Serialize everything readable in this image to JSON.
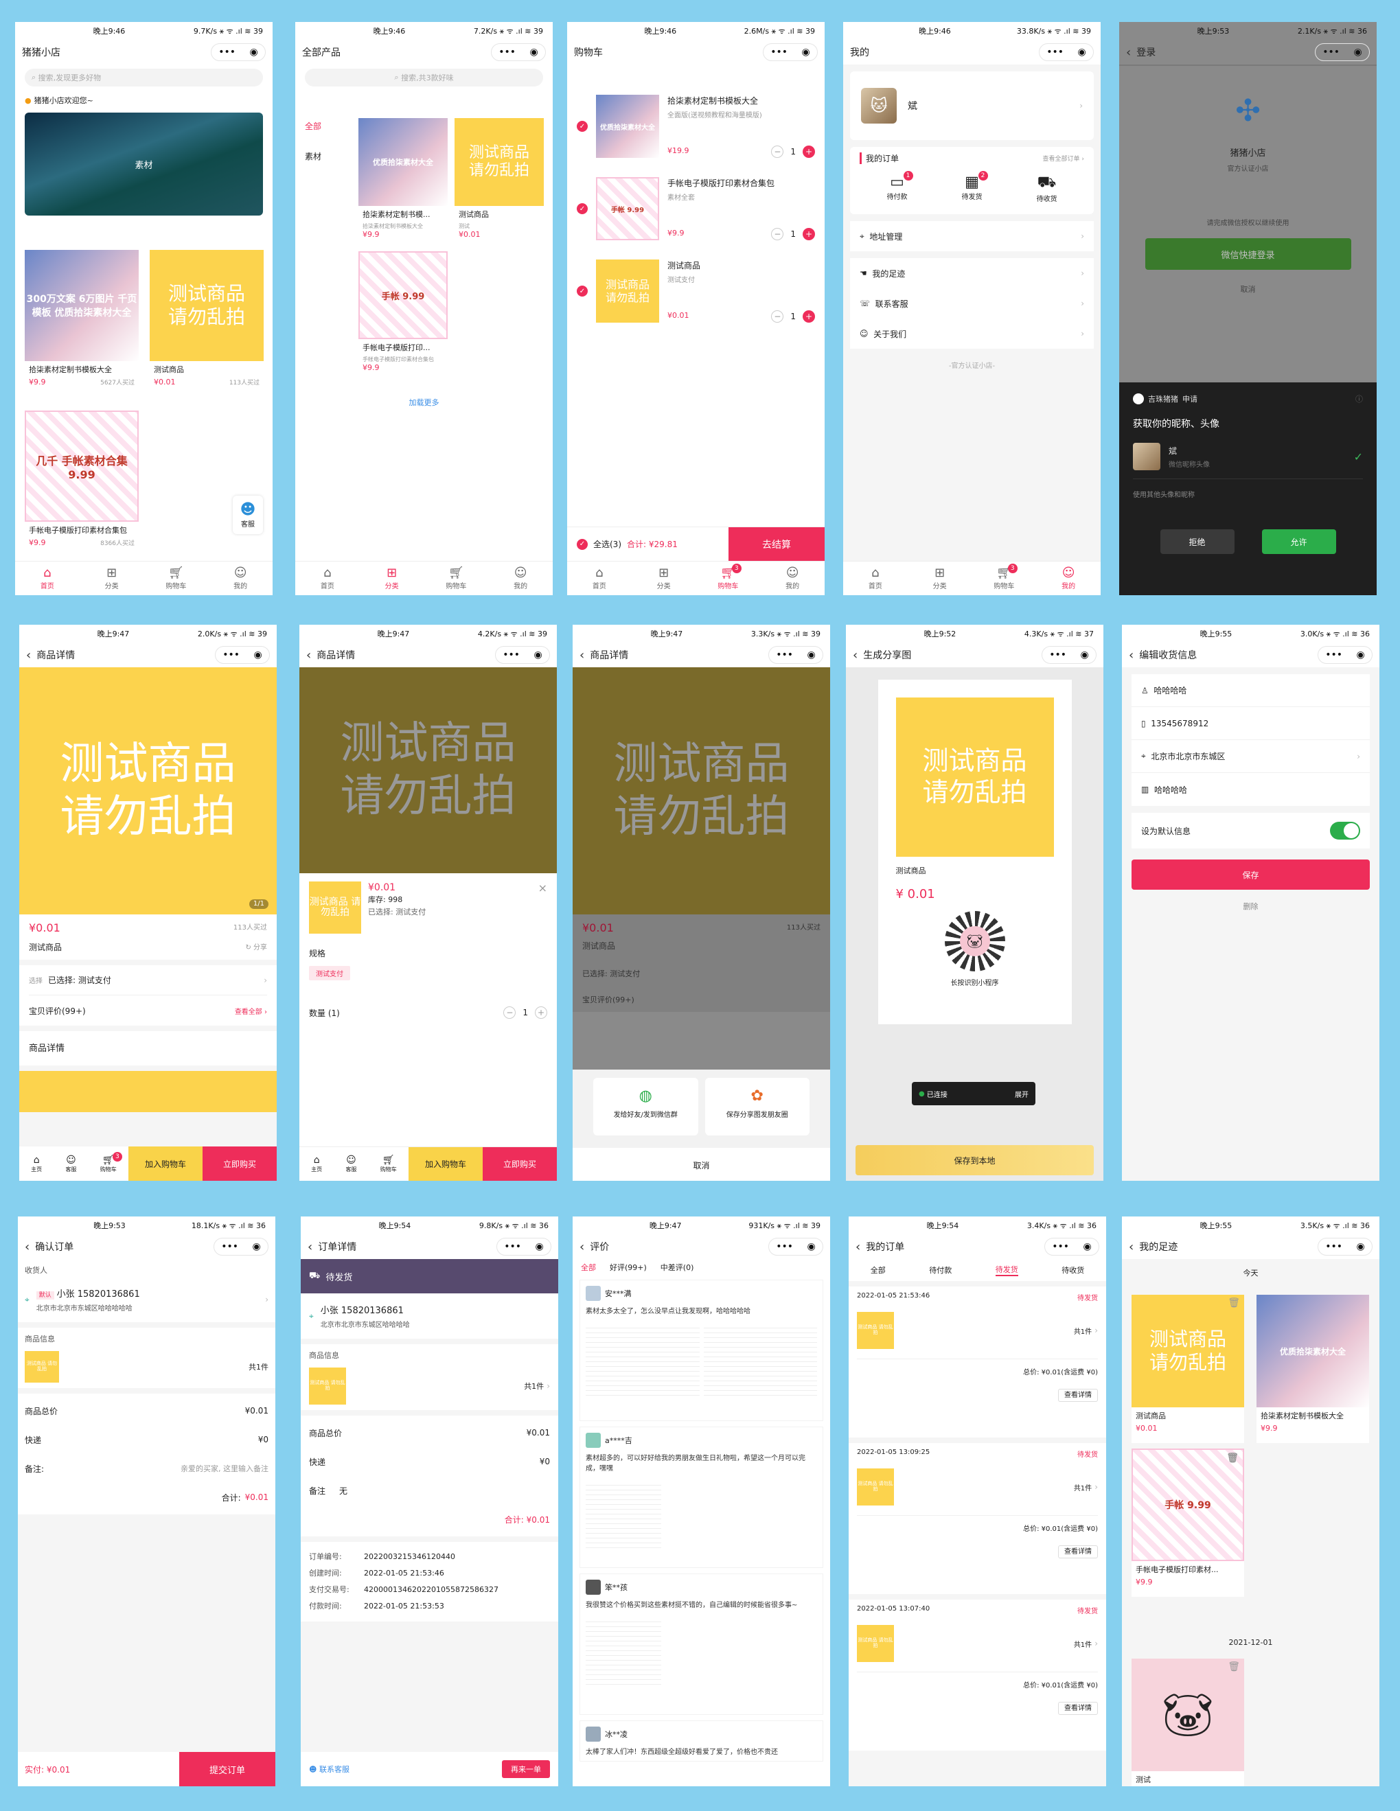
{
  "p1": {
    "status": {
      "time": "晚上9:46",
      "net": "9.7K/s ⚹ ᯤ .ıl ≋ 39"
    },
    "title": "猪猪小店",
    "search": "搜索,发现更多好物",
    "notice": "猪猪小店欢迎您~",
    "banner": "素材",
    "goods": [
      {
        "name": "拾柒素材定制书模板大全",
        "price": "¥9.9",
        "sold": "5627人买过",
        "poster": "300万文案 6万图片 千页模板 优质拾柒素材大全"
      },
      {
        "name": "测试商品",
        "price": "¥0.01",
        "sold": "113人买过",
        "poster": "测试商品 请勿乱拍"
      },
      {
        "name": "手帐电子模版打印素材合集包",
        "price": "¥9.9",
        "sold": "8366人买过",
        "poster": "几千 手帐素材合集 9.99"
      }
    ],
    "service": "客服",
    "tabs": [
      "首页",
      "分类",
      "购物车",
      "我的"
    ]
  },
  "p2": {
    "status": {
      "time": "晚上9:46",
      "net": "7.2K/s ⚹ ᯤ .ıl ≋ 39"
    },
    "title": "全部产品",
    "search": "搜索,共3款好味",
    "cats": [
      "全部",
      "素材"
    ],
    "goods": [
      {
        "name": "拾柒素材定制书模...",
        "sub": "拾柒素材定制书模板大全",
        "price": "¥9.9"
      },
      {
        "name": "测试商品",
        "sub": "测试",
        "price": "¥0.01"
      },
      {
        "name": "手帐电子模版打印...",
        "sub": "手帐电子模版打印素材合集包",
        "price": "¥9.9"
      }
    ],
    "more": "加载更多",
    "tabs": [
      "首页",
      "分类",
      "购物车",
      "我的"
    ]
  },
  "p3": {
    "status": {
      "time": "晚上9:46",
      "net": "2.6M/s ⚹ ᯤ .ıl ≋ 39"
    },
    "title": "购物车",
    "items": [
      {
        "name": "拾柒素材定制书模板大全",
        "spec": "全面版(送视频教程和海量模版)",
        "price": "¥19.9",
        "qty": "1"
      },
      {
        "name": "手帐电子模版打印素材合集包",
        "spec": "素材全套",
        "price": "¥9.9",
        "qty": "1"
      },
      {
        "name": "测试商品",
        "spec": "测试支付",
        "price": "¥0.01",
        "qty": "1"
      }
    ],
    "all": "全选(3)",
    "total": "合计: ¥29.81",
    "checkout": "去结算",
    "badge": "3",
    "tabs": [
      "首页",
      "分类",
      "购物车",
      "我的"
    ]
  },
  "p4": {
    "status": {
      "time": "晚上9:46",
      "net": "33.8K/s ⚹ ᯤ .ıl ≋ 39"
    },
    "title": "我的",
    "user": "斌",
    "orders": "我的订单",
    "all_orders": "查看全部订单 ›",
    "order_types": [
      {
        "label": "待付款",
        "n": "1"
      },
      {
        "label": "待发货",
        "n": "2"
      },
      {
        "label": "待收货",
        "n": ""
      }
    ],
    "menu": [
      "地址管理",
      "我的足迹",
      "联系客服",
      "关于我们"
    ],
    "footer": "-官方认证小店-",
    "badge": "3",
    "tabs": [
      "首页",
      "分类",
      "购物车",
      "我的"
    ]
  },
  "p5": {
    "status": {
      "time": "晚上9:53",
      "net": "2.1K/s ⚹ ᯤ .ıl ≋ 36"
    },
    "title": "登录",
    "shop": "猪猪小店",
    "cert": "官方认证小店",
    "tip": "请完成微信授权以继续使用",
    "wx": "微信快捷登录",
    "cancel": "取消",
    "app": "吉珠猪猪",
    "apply": "申请",
    "ask": "获取你的昵称、头像",
    "nick": "斌",
    "nick_sub": "微信昵称头像",
    "other": "使用其他头像和昵称",
    "deny": "拒绝",
    "allow": "允许"
  },
  "p6": {
    "status": {
      "time": "晚上9:47",
      "net": "2.0K/s ⚹ ᯤ .ıl ≋ 39"
    },
    "title": "商品详情",
    "poster": [
      "测试商品",
      "请勿乱拍"
    ],
    "page": "1/1",
    "price": "¥0.01",
    "sold": "113人买过",
    "name": "测试商品",
    "share": "分享",
    "sel_l": "选择",
    "sel": "已选择: 测试支付",
    "review": "宝贝评价(99+)",
    "review_all": "查看全部 ›",
    "detail": "商品详情",
    "bar": [
      "主页",
      "客服",
      "购物车"
    ],
    "add": "加入购物车",
    "buy": "立即购买",
    "badge": "3"
  },
  "p7": {
    "status": {
      "time": "晚上9:47",
      "net": "4.2K/s ⚹ ᯤ .ıl ≋ 39"
    },
    "title": "商品详情",
    "price": "¥0.01",
    "stock": "库存: 998",
    "selected": "已选择: 测试支付",
    "spec_l": "规格",
    "spec": "测试支付",
    "num_l": "数量 (1)",
    "num": "1",
    "bar": [
      "主页",
      "客服",
      "购物车"
    ],
    "add": "加入购物车",
    "buy": "立即购买"
  },
  "p8": {
    "status": {
      "time": "晚上9:47",
      "net": "3.3K/s ⚹ ᯤ .ıl ≋ 39"
    },
    "title": "商品详情",
    "share1": "发给好友/发到微信群",
    "share2": "保存分享图发朋友圈",
    "cancel": "取消"
  },
  "p9": {
    "status": {
      "time": "晚上9:52",
      "net": "4.3K/s ⚹ ᯤ .ıl ≋ 37"
    },
    "title": "生成分享图",
    "name": "测试商品",
    "price": "¥ 0.01",
    "qr": "长按识别小程序",
    "conn": "已连接",
    "expand": "展开",
    "save": "保存到本地"
  },
  "p10": {
    "status": {
      "time": "晚上9:55",
      "net": "3.0K/s ⚹ ᯤ .ıl ≋ 36"
    },
    "title": "编辑收货信息",
    "name": "哈哈哈哈",
    "phone": "13545678912",
    "region": "北京市北京市东城区",
    "addr": "哈哈哈哈",
    "def": "设为默认信息",
    "save": "保存",
    "del": "删除"
  },
  "p11": {
    "status": {
      "time": "晚上9:53",
      "net": "18.1K/s ⚹ ᯤ .ıl ≋ 36"
    },
    "title": "确认订单",
    "recv": "收货人",
    "tag": "默认",
    "person": "小张 15820136861",
    "addr": "北京市北京市东城区哈哈哈哈哈",
    "info": "商品信息",
    "count": "共1件",
    "total_l": "商品总价",
    "total": "¥0.01",
    "ship_l": "快递",
    "ship": "¥0",
    "note_l": "备注:",
    "note": "亲爱的买家, 这里输入备注",
    "sum_l": "合计:",
    "sum": "¥0.01",
    "pay": "实付: ¥0.01",
    "submit": "提交订单"
  },
  "p12": {
    "status": {
      "time": "晚上9:54",
      "net": "9.8K/s ⚹ ᯤ .ıl ≋ 36"
    },
    "title": "订单详情",
    "state": "待发货",
    "person": "小张 15820136861",
    "addr": "北京市北京市东城区哈哈哈哈",
    "info": "商品信息",
    "count": "共1件",
    "total_l": "商品总价",
    "total": "¥0.01",
    "ship_l": "快递",
    "ship": "¥0",
    "note_l": "备注",
    "note": "无",
    "sum": "合计: ¥0.01",
    "meta": [
      [
        "订单编号:",
        "2022003215346120440"
      ],
      [
        "创建时间:",
        "2022-01-05 21:53:46"
      ],
      [
        "支付交易号:",
        "4200001346202201055872586327"
      ],
      [
        "付款时间:",
        "2022-01-05 21:53:53"
      ]
    ],
    "contact": "联系客服",
    "again": "再来一单"
  },
  "p13": {
    "status": {
      "time": "晚上9:47",
      "net": "931K/s ⚹ ᯤ .ıl ≋ 39"
    },
    "title": "评价",
    "tabs": [
      "全部",
      "好评(99+)",
      "中差评(0)"
    ],
    "reviews": [
      {
        "user": "安***满",
        "text": "素材太多太全了，怎么没早点让我发现啊，哈哈哈哈哈"
      },
      {
        "user": "a****吉",
        "text": "素材超多的，可以好好给我的男朋友做生日礼物啦，希望这一个月可以完成，嘿嘿"
      },
      {
        "user": "笨**孩",
        "text": "我很赞这个价格买到这些素材挺不错的，自己编辑的时候能省很多事~"
      },
      {
        "user": "冰**凌",
        "text": "太棒了家人们冲！东西超级全超级好看爱了爱了，价格也不贵还"
      }
    ]
  },
  "p14": {
    "status": {
      "time": "晚上9:54",
      "net": "3.4K/s ⚹ ᯤ .ıl ≋ 36"
    },
    "title": "我的订单",
    "tabs": [
      "全部",
      "待付款",
      "待发货",
      "待收货"
    ],
    "orders": [
      {
        "time": "2022-01-05 21:53:46",
        "state": "待发货",
        "count": "共1件",
        "sum": "总价: ¥0.01(含运费 ¥0)",
        "btn": "查看详情"
      },
      {
        "time": "2022-01-05 13:09:25",
        "state": "待发货",
        "count": "共1件",
        "sum": "总价: ¥0.01(含运费 ¥0)",
        "btn": "查看详情"
      },
      {
        "time": "2022-01-05 13:07:40",
        "state": "待发货",
        "count": "共1件",
        "sum": "总价: ¥0.01(含运费 ¥0)",
        "btn": "查看详情"
      }
    ]
  },
  "p15": {
    "status": {
      "time": "晚上9:55",
      "net": "3.5K/s ⚹ ᯤ .ıl ≋ 36"
    },
    "title": "我的足迹",
    "today": "今天",
    "items": [
      {
        "name": "测试商品",
        "price": "¥0.01"
      },
      {
        "name": "拾柒素材定制书模板大全",
        "price": "¥9.9"
      },
      {
        "name": "手帐电子模版打印素材...",
        "price": "¥9.9"
      }
    ],
    "date2": "2021-12-01",
    "item4": "测试"
  }
}
